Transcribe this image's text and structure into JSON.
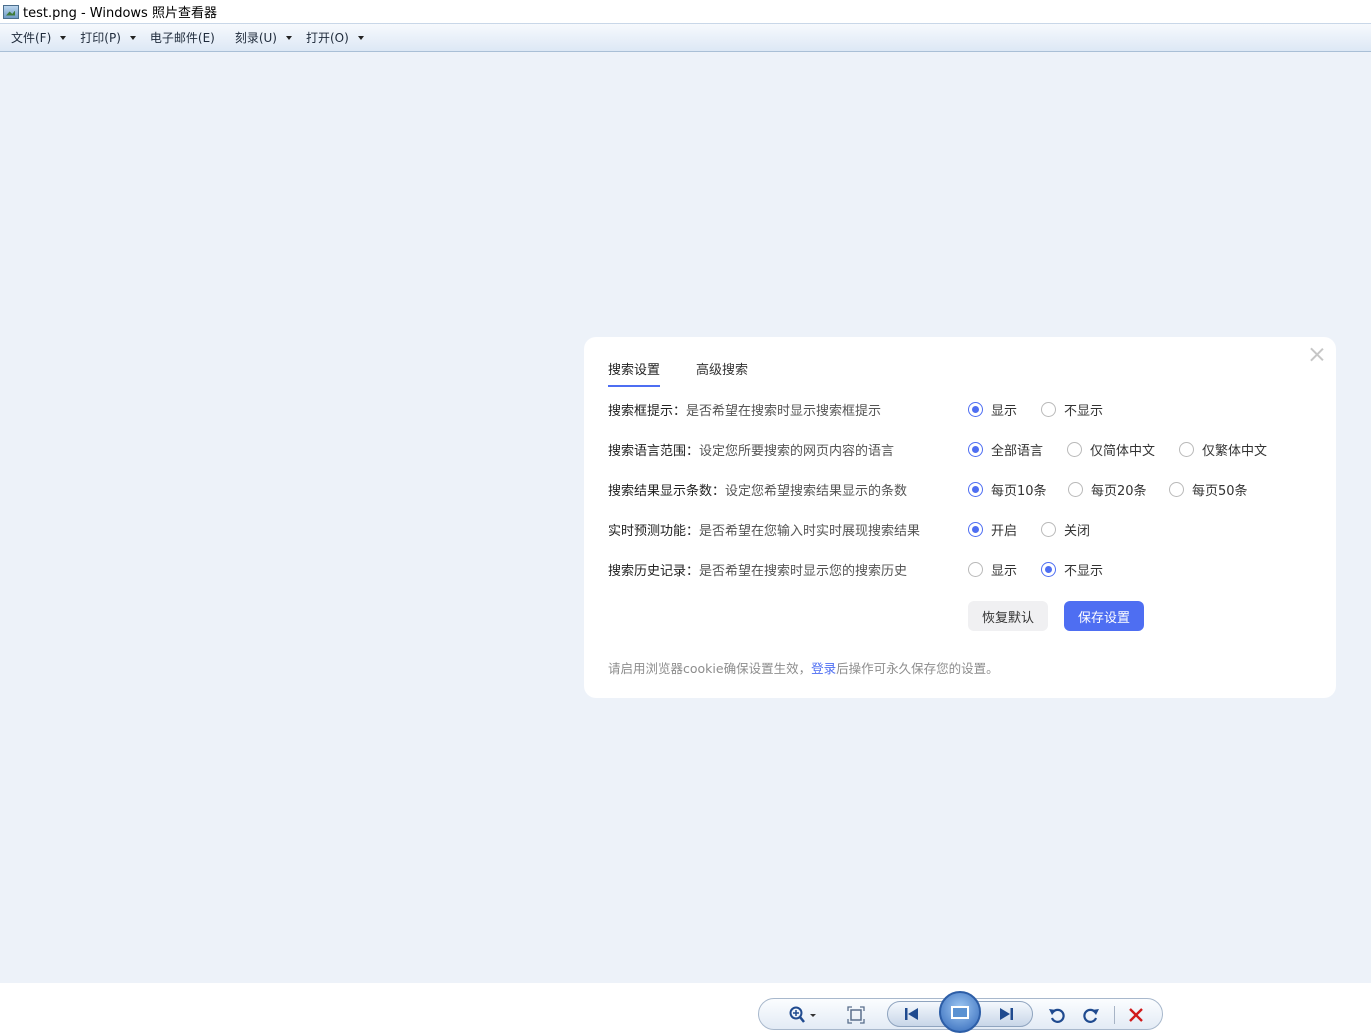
{
  "window": {
    "title": "test.png - Windows 照片查看器",
    "icon": "photo-viewer-icon"
  },
  "menu": [
    {
      "label": "文件(F)",
      "has_dropdown": true
    },
    {
      "label": "打印(P)",
      "has_dropdown": true
    },
    {
      "label": "电子邮件(E)",
      "has_dropdown": false
    },
    {
      "label": "刻录(U)",
      "has_dropdown": true
    },
    {
      "label": "打开(O)",
      "has_dropdown": true
    }
  ],
  "dialog": {
    "tabs": [
      {
        "label": "搜索设置",
        "active": true
      },
      {
        "label": "高级搜索",
        "active": false
      }
    ],
    "rows": [
      {
        "title": "搜索框提示：",
        "desc": "是否希望在搜索时显示搜索框提示",
        "options": [
          "显示",
          "不显示"
        ],
        "selected": 0
      },
      {
        "title": "搜索语言范围：",
        "desc": "设定您所要搜索的网页内容的语言",
        "options": [
          "全部语言",
          "仅简体中文",
          "仅繁体中文"
        ],
        "selected": 0
      },
      {
        "title": "搜索结果显示条数：",
        "desc": "设定您希望搜索结果显示的条数",
        "options": [
          "每页10条",
          "每页20条",
          "每页50条"
        ],
        "selected": 0
      },
      {
        "title": "实时预测功能：",
        "desc": "是否希望在您输入时实时展现搜索结果",
        "options": [
          "开启",
          "关闭"
        ],
        "selected": 0
      },
      {
        "title": "搜索历史记录：",
        "desc": "是否希望在搜索时显示您的搜索历史",
        "options": [
          "显示",
          "不显示"
        ],
        "selected": 1
      }
    ],
    "buttons": {
      "reset": "恢复默认",
      "save": "保存设置"
    },
    "footnote": {
      "before": "请启用浏览器cookie确保设置生效，",
      "link": "登录",
      "after": "后操作可永久保存您的设置。"
    }
  },
  "colors": {
    "accent": "#4e6ef2",
    "canvas": "#edf2f9"
  },
  "toolbar_icons": [
    "zoom-icon",
    "actual-size-icon",
    "previous-icon",
    "slideshow-icon",
    "next-icon",
    "rotate-counterclockwise-icon",
    "rotate-clockwise-icon",
    "delete-icon"
  ]
}
